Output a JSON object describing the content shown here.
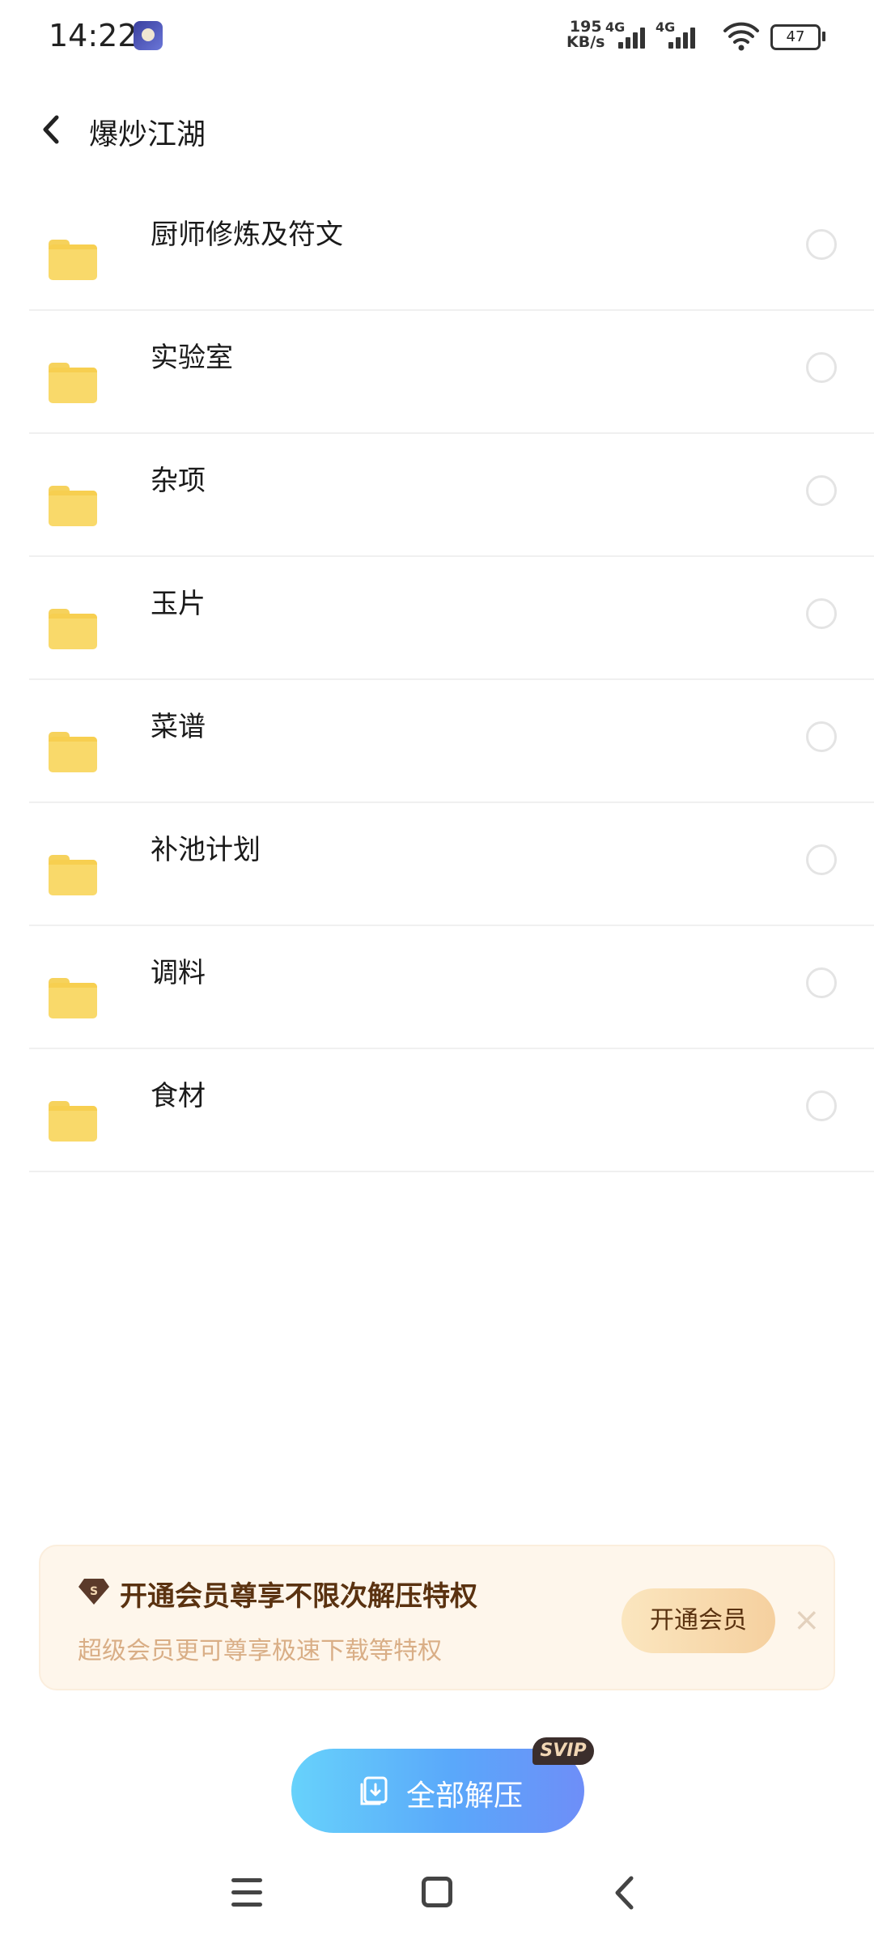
{
  "status_bar": {
    "time": "14:22",
    "speed_value": "195",
    "speed_unit": "KB/s",
    "network_1": "4G",
    "network_2": "4G",
    "battery": "47",
    "app_icon": "app-notification-icon"
  },
  "header": {
    "back_icon": "chevron-left-icon",
    "title": "爆炒江湖"
  },
  "folders": [
    {
      "name": "厨师修炼及符文",
      "icon": "folder-icon"
    },
    {
      "name": "实验室",
      "icon": "folder-icon"
    },
    {
      "name": "杂项",
      "icon": "folder-icon"
    },
    {
      "name": "玉片",
      "icon": "folder-icon"
    },
    {
      "name": "菜谱",
      "icon": "folder-icon"
    },
    {
      "name": "补池计划",
      "icon": "folder-icon"
    },
    {
      "name": "调料",
      "icon": "folder-icon"
    },
    {
      "name": "食材",
      "icon": "folder-icon"
    }
  ],
  "vip_banner": {
    "title": "开通会员尊享不限次解压特权",
    "subtitle": "超级会员更可尊享极速下载等特权",
    "button": "开通会员",
    "close": "×",
    "icon": "diamond-s-icon"
  },
  "extract": {
    "label": "全部解压",
    "tag": "SVIP",
    "icon": "extract-icon"
  },
  "nav": {
    "menu_icon": "menu-icon",
    "home_icon": "home-icon",
    "back_icon": "back-icon"
  },
  "colors": {
    "folder": "#f9d96a",
    "vip_bg": "#fef6eb",
    "vip_title": "#5a3210",
    "button_gradient_start": "#67d2fb",
    "button_gradient_end": "#6e8ef8"
  }
}
